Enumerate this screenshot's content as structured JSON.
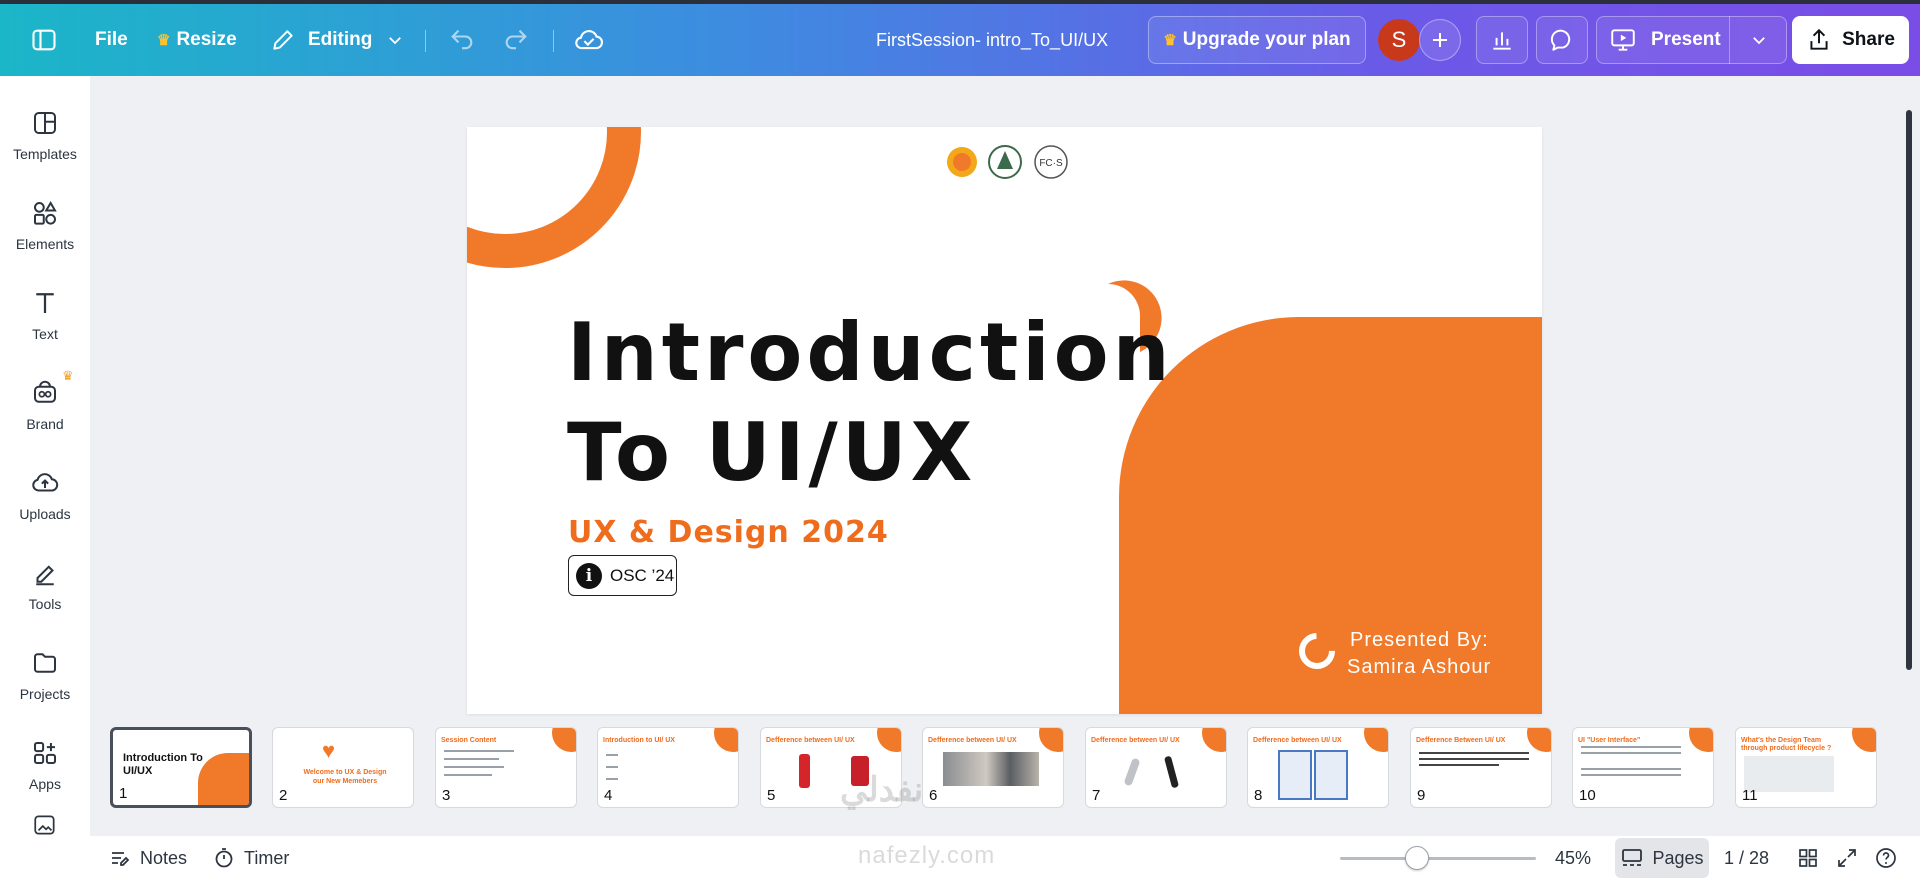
{
  "header": {
    "file_label": "File",
    "resize_label": "Resize",
    "editing_label": "Editing",
    "doc_title": "FirstSession- intro_To_UI/UX",
    "upgrade_label": "Upgrade your plan",
    "avatar_initial": "S",
    "present_label": "Present",
    "share_label": "Share"
  },
  "sidebar": {
    "items": [
      {
        "label": "Templates",
        "icon": "templates-icon"
      },
      {
        "label": "Elements",
        "icon": "elements-icon"
      },
      {
        "label": "Text",
        "icon": "text-icon"
      },
      {
        "label": "Brand",
        "icon": "brand-icon"
      },
      {
        "label": "Uploads",
        "icon": "uploads-icon"
      },
      {
        "label": "Tools",
        "icon": "tools-icon"
      },
      {
        "label": "Projects",
        "icon": "projects-icon"
      },
      {
        "label": "Apps",
        "icon": "apps-icon"
      }
    ]
  },
  "slide": {
    "title_line1": "Introduction",
    "title_line2": "To UI/UX",
    "subtitle": "UX & Design 2024",
    "badge": "OSC ’24",
    "presented_by": "Presented By:",
    "presenter": "Samira Ashour",
    "accent": "#f07a2a"
  },
  "thumbnails": [
    {
      "num": "1",
      "title": "Introduction To UI/UX"
    },
    {
      "num": "2",
      "title": "Welcome to UX & Design our New Memebers"
    },
    {
      "num": "3",
      "title": "Session Content"
    },
    {
      "num": "4",
      "title": "Introduction to UI/ UX"
    },
    {
      "num": "5",
      "title": "Defference between UI/ UX"
    },
    {
      "num": "6",
      "title": "Defference between UI/ UX"
    },
    {
      "num": "7",
      "title": "Defference between UI/ UX"
    },
    {
      "num": "8",
      "title": "Defference between UI/ UX"
    },
    {
      "num": "9",
      "title": "Defference Between UI/ UX"
    },
    {
      "num": "10",
      "title": "UI \"User Interface\""
    },
    {
      "num": "11",
      "title": "What's the Design Team through product lifecycle ?"
    }
  ],
  "footer": {
    "notes_label": "Notes",
    "timer_label": "Timer",
    "zoom": "45%",
    "zoom_fraction": 0.45,
    "pages_label": "Pages",
    "page_indicator": "1 / 28"
  },
  "watermark": {
    "arabic": "نفدلي",
    "site": "nafezly.com"
  }
}
